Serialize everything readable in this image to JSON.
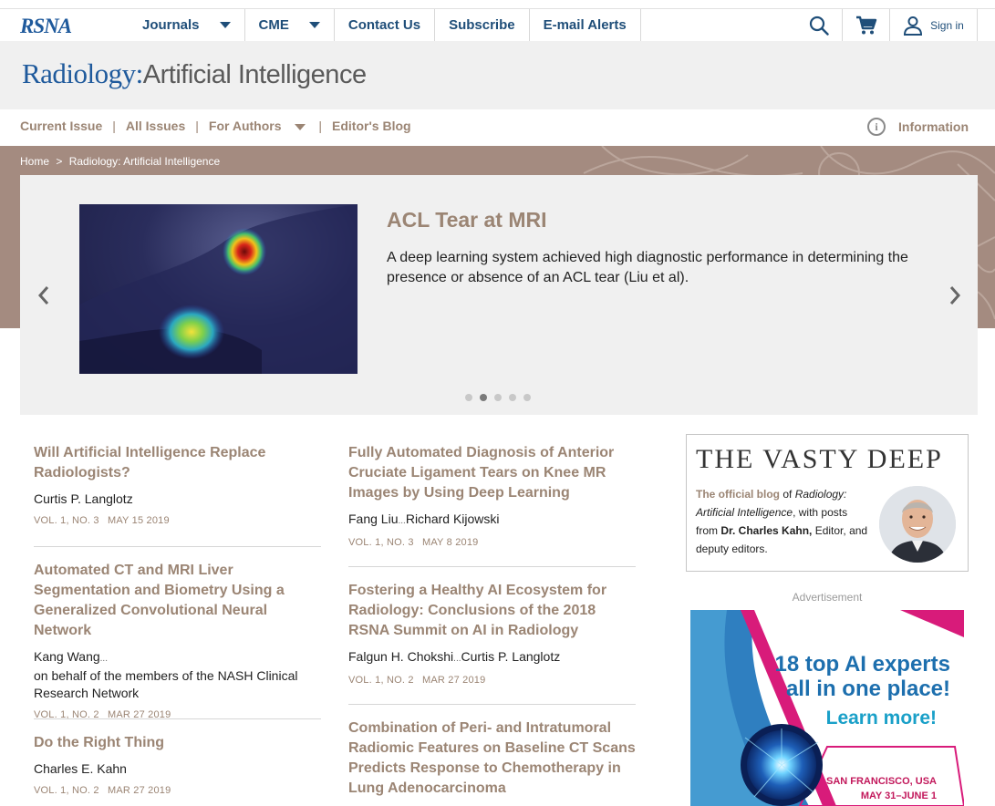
{
  "topnav": {
    "logo": "RSNA",
    "items": [
      {
        "label": "Journals",
        "has_caret": true
      },
      {
        "label": "CME",
        "has_caret": true
      },
      {
        "label": "Contact Us",
        "has_caret": false
      },
      {
        "label": "Subscribe",
        "has_caret": false
      },
      {
        "label": "E-mail Alerts",
        "has_caret": false
      }
    ],
    "search_icon": "search-icon",
    "cart_icon": "cart-icon",
    "user_icon": "user-icon",
    "signin_label": "Sign in"
  },
  "journal": {
    "title_prefix": "Radiology:",
    "title_suffix": "Artificial Intelligence"
  },
  "subnav": {
    "items": [
      "Current Issue",
      "All Issues",
      "For Authors",
      "Editor's Blog"
    ],
    "info_label": "Information"
  },
  "breadcrumb": {
    "home": "Home",
    "separator": ">",
    "current": "Radiology: Artificial Intelligence"
  },
  "carousel": {
    "title": "ACL Tear at MRI",
    "text": "A deep learning system achieved high diagnostic performance in determining the presence or absence of an ACL tear (Liu et al).",
    "dot_count": 5,
    "active_dot": 1
  },
  "articles_left": [
    {
      "title": "Will Artificial Intelligence Replace Radiologists?",
      "author": "Curtis P. Langlotz",
      "author2": "",
      "extra": "",
      "vol": "VOL. 1, NO. 3",
      "date": "MAY 15 2019"
    },
    {
      "title": "Automated CT and MRI Liver Segmentation and Biometry Using a Generalized Convolutional Neural Network",
      "author": "Kang Wang",
      "author2": "",
      "extra": "on behalf of the members of the NASH Clinical Research Network",
      "vol": "VOL. 1, NO. 2",
      "date": "MAR 27 2019"
    },
    {
      "title": "Do the Right Thing",
      "author": "Charles E. Kahn",
      "author2": "",
      "extra": "",
      "vol": "VOL. 1, NO. 2",
      "date": "MAR 27 2019"
    }
  ],
  "articles_mid": [
    {
      "title": "Fully Automated Diagnosis of Anterior Cruciate Ligament Tears on Knee MR Images by Using Deep Learning",
      "author": "Fang Liu",
      "author2": "Richard Kijowski",
      "extra": "",
      "vol": "VOL. 1, NO. 3",
      "date": "MAY 8 2019"
    },
    {
      "title": "Fostering a Healthy AI Ecosystem for Radiology: Conclusions of the 2018 RSNA Summit on AI in Radiology",
      "author": "Falgun H. Chokshi",
      "author2": "Curtis P. Langlotz",
      "extra": "",
      "vol": "VOL. 1, NO. 2",
      "date": "MAR 27 2019"
    },
    {
      "title": "Combination of Peri- and Intratumoral Radiomic Features on Baseline CT Scans Predicts Response to Chemotherapy in Lung Adenocarcinoma",
      "author": "",
      "author2": "",
      "extra": "",
      "vol": "",
      "date": ""
    }
  ],
  "ellipsis": "...",
  "blog": {
    "title": "THE VASTY DEEP",
    "lead": "The official blog",
    "t1": " of ",
    "journal": "Radiology: Artificial Intelligence",
    "t2": ", with posts from ",
    "editor": "Dr. Charles Kahn,",
    "t3": " Editor, and deputy editors."
  },
  "ad": {
    "label": "Advertisement",
    "line1": "18 top AI experts",
    "line2": "all in one place!",
    "cta": "Learn more!",
    "location": "SAN FRANCISCO, USA",
    "dates": "MAY 31–JUNE 1"
  },
  "colors": {
    "accent": "#9b8574",
    "navy": "#1f4e79",
    "banner": "#a48b80"
  }
}
